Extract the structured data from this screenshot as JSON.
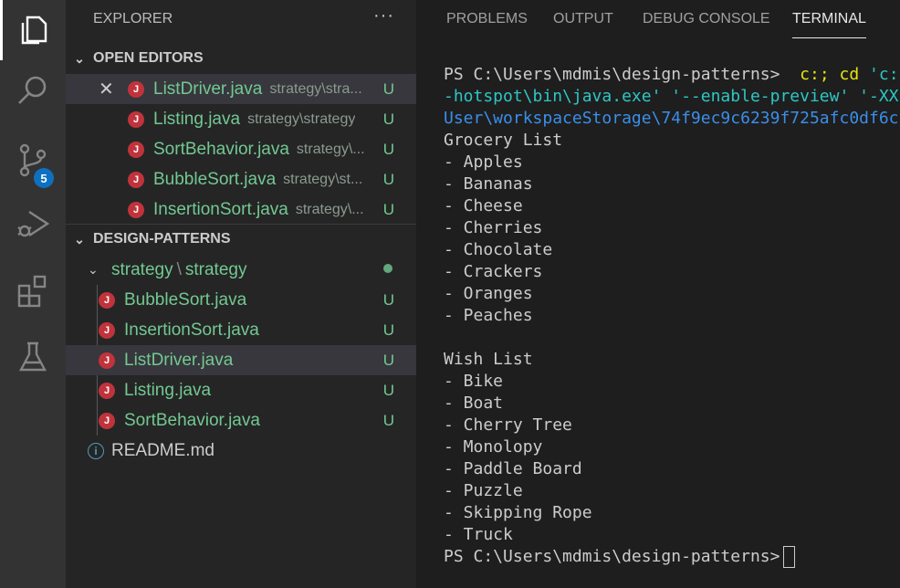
{
  "activity_bar": {
    "items": [
      {
        "icon": "explorer-icon",
        "active": true
      },
      {
        "icon": "search-icon"
      },
      {
        "icon": "source-control-icon",
        "badge": "5"
      },
      {
        "icon": "run-debug-icon"
      },
      {
        "icon": "extensions-icon"
      },
      {
        "icon": "testing-icon"
      }
    ]
  },
  "explorer": {
    "title": "EXPLORER",
    "more": "···",
    "open_editors": {
      "title": "OPEN EDITORS",
      "items": [
        {
          "name": "ListDriver.java",
          "path": "strategy\\stra...",
          "status": "U"
        },
        {
          "name": "Listing.java",
          "path": "strategy\\strategy",
          "status": "U"
        },
        {
          "name": "SortBehavior.java",
          "path": "strategy\\...",
          "status": "U"
        },
        {
          "name": "BubbleSort.java",
          "path": "strategy\\st...",
          "status": "U"
        },
        {
          "name": "InsertionSort.java",
          "path": "strategy\\...",
          "status": "U"
        }
      ]
    },
    "project": {
      "title": "DESIGN-PATTERNS",
      "folder": {
        "part1": "strategy",
        "sep": "\\",
        "part2": "strategy"
      },
      "files": [
        {
          "name": "BubbleSort.java",
          "status": "U"
        },
        {
          "name": "InsertionSort.java",
          "status": "U"
        },
        {
          "name": "ListDriver.java",
          "status": "U"
        },
        {
          "name": "Listing.java",
          "status": "U"
        },
        {
          "name": "SortBehavior.java",
          "status": "U"
        }
      ],
      "readme": "README.md"
    }
  },
  "panel": {
    "tabs": [
      "PROBLEMS",
      "OUTPUT",
      "DEBUG CONSOLE",
      "TERMINAL"
    ],
    "active_tab": "TERMINAL",
    "terminal": {
      "prompt": "PS C:\\Users\\mdmis\\design-patterns>",
      "cmd_part1": "c:;",
      "cmd_part2": "cd",
      "cmd_part3": "'c:",
      "line2": "-hotspot\\bin\\java.exe' '--enable-preview' '-XX",
      "line3": "User\\workspaceStorage\\74f9ec9c6239f725afc0df6c",
      "output": [
        "Grocery List",
        "- Apples",
        "- Bananas",
        "- Cheese",
        "- Cherries",
        "- Chocolate",
        "- Crackers",
        "- Oranges",
        "- Peaches",
        "",
        "Wish List",
        "- Bike",
        "- Boat",
        "- Cherry Tree",
        "- Monolopy",
        "- Paddle Board",
        "- Puzzle",
        "- Skipping Rope",
        "- Truck"
      ],
      "final_prompt": "PS C:\\Users\\mdmis\\design-patterns>"
    }
  },
  "colors": {
    "accent": "#0e70c0",
    "untracked": "#73c991",
    "java_icon": "#c1333c"
  }
}
